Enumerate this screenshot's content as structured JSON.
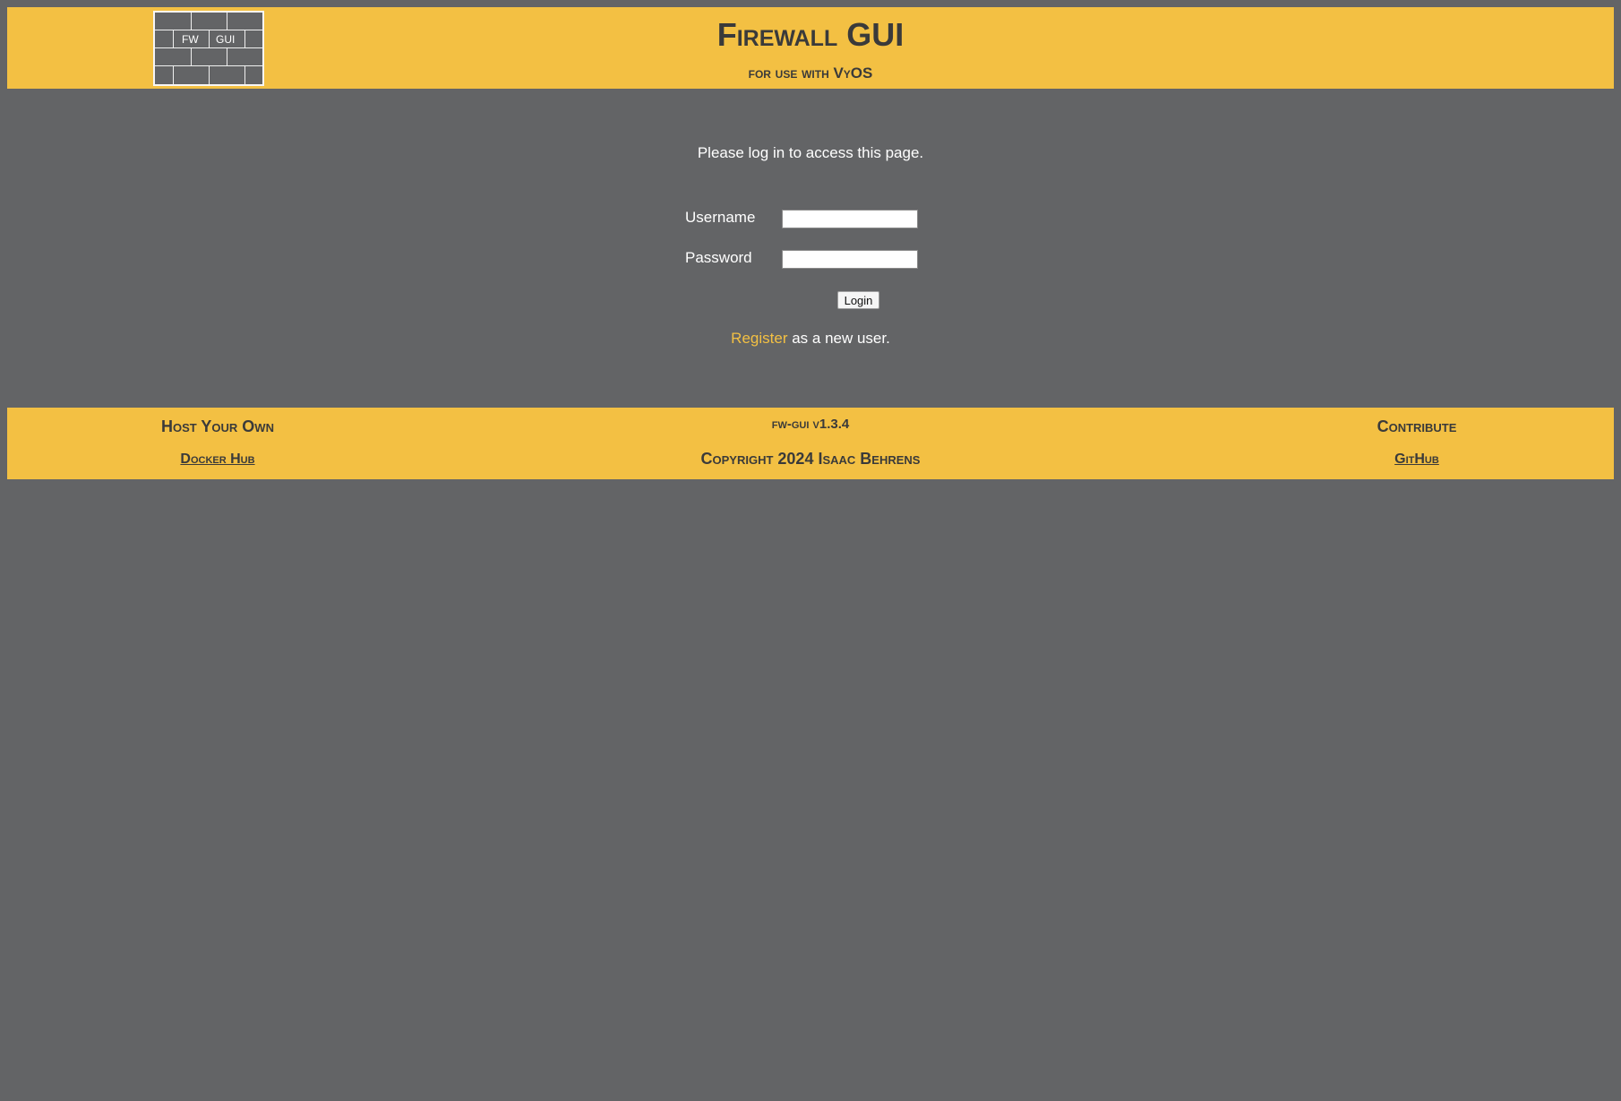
{
  "header": {
    "title": "Firewall GUI",
    "subtitle": "for use with VyOS",
    "logo": {
      "label_fw": "FW",
      "label_gui": "GUI"
    }
  },
  "main": {
    "message": "Please log in to access this page.",
    "username_label": "Username",
    "username_value": "",
    "password_label": "Password",
    "password_value": "",
    "login_button": "Login",
    "register_link": "Register",
    "register_suffix": " as a new user."
  },
  "footer": {
    "host_title": "Host Your Own",
    "host_link": "Docker Hub",
    "version": "fw-gui v1.3.4",
    "copyright": "Copyright 2024 Isaac Behrens",
    "contribute_title": "Contribute",
    "contribute_link": "GitHub"
  },
  "colors": {
    "accent": "#f3c043",
    "background": "#636466",
    "text_dark": "#3a3a3a"
  }
}
